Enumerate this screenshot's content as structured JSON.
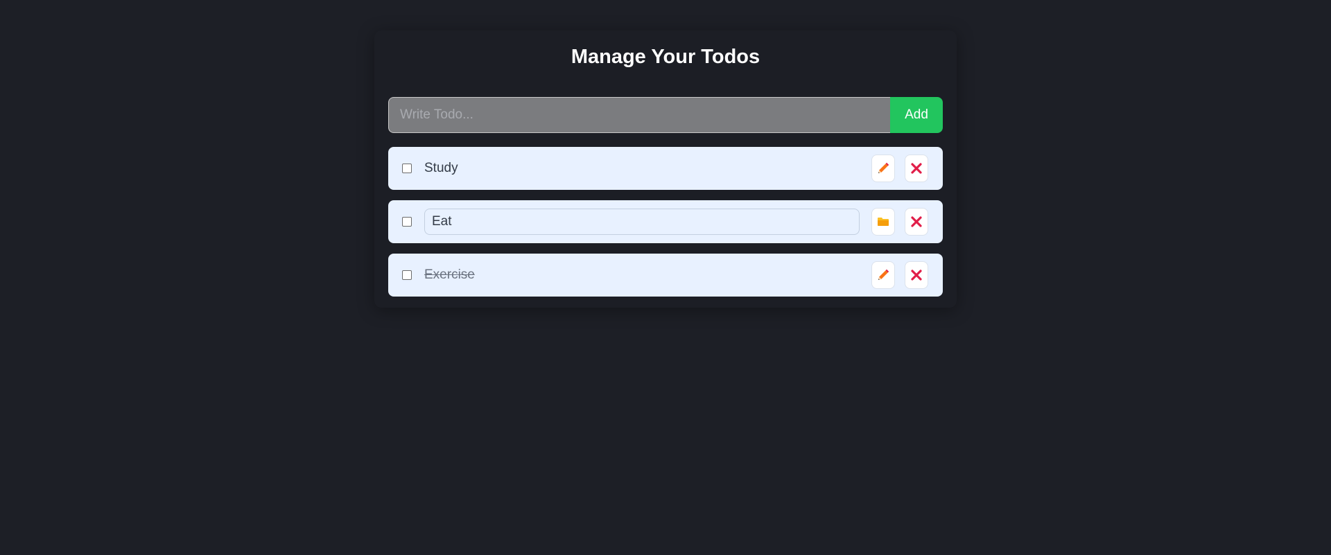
{
  "header": {
    "title": "Manage Your Todos"
  },
  "form": {
    "placeholder": "Write Todo...",
    "value": "",
    "add_label": "Add"
  },
  "todos": [
    {
      "text": "Study",
      "completed": false,
      "editing": false,
      "action_icon": "pencil-icon"
    },
    {
      "text": "Eat",
      "completed": false,
      "editing": true,
      "action_icon": "folder-icon"
    },
    {
      "text": "Exercise",
      "completed": true,
      "editing": false,
      "action_icon": "pencil-icon"
    }
  ],
  "colors": {
    "background": "#1d1f26",
    "input_bg": "#7b7c7f",
    "add_button": "#22c55e",
    "todo_bg": "#e8f1ff",
    "edit_icon": "#f97316",
    "save_icon": "#fbbf24",
    "delete_icon": "#e11d48"
  }
}
